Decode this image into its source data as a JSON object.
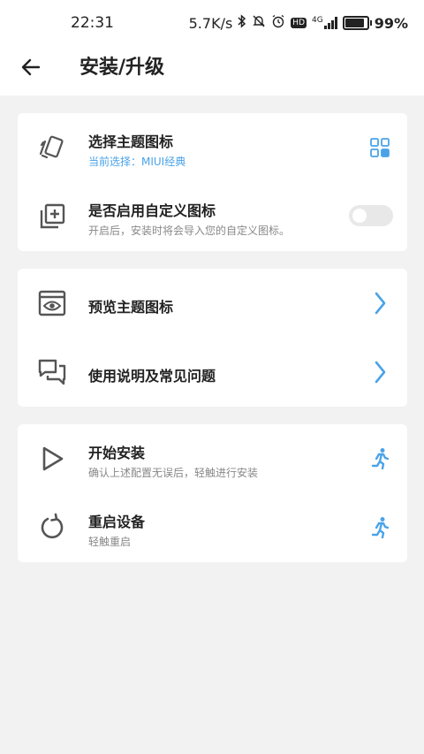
{
  "status_bar": {
    "time": "22:31",
    "net_speed": "5.7K/s",
    "network": "4G",
    "hd": "HD",
    "battery": "99%"
  },
  "header": {
    "title": "安装/升级"
  },
  "card1": {
    "theme_icon": {
      "title": "选择主题图标",
      "subtitle": "当前选择：MIUI经典"
    },
    "custom_icon": {
      "title": "是否启用自定义图标",
      "subtitle": "开启后，安装时将会导入您的自定义图标。",
      "toggle_on": false
    }
  },
  "card2": {
    "preview": {
      "title": "预览主题图标"
    },
    "help": {
      "title": "使用说明及常见问题"
    }
  },
  "card3": {
    "install": {
      "title": "开始安装",
      "subtitle": "确认上述配置无误后，轻触进行安装"
    },
    "reboot": {
      "title": "重启设备",
      "subtitle": "轻触重启"
    }
  },
  "colors": {
    "accent": "#4aa3e8",
    "background": "#f2f2f2",
    "card": "#ffffff",
    "toggle_off": "#e8e8e8"
  }
}
